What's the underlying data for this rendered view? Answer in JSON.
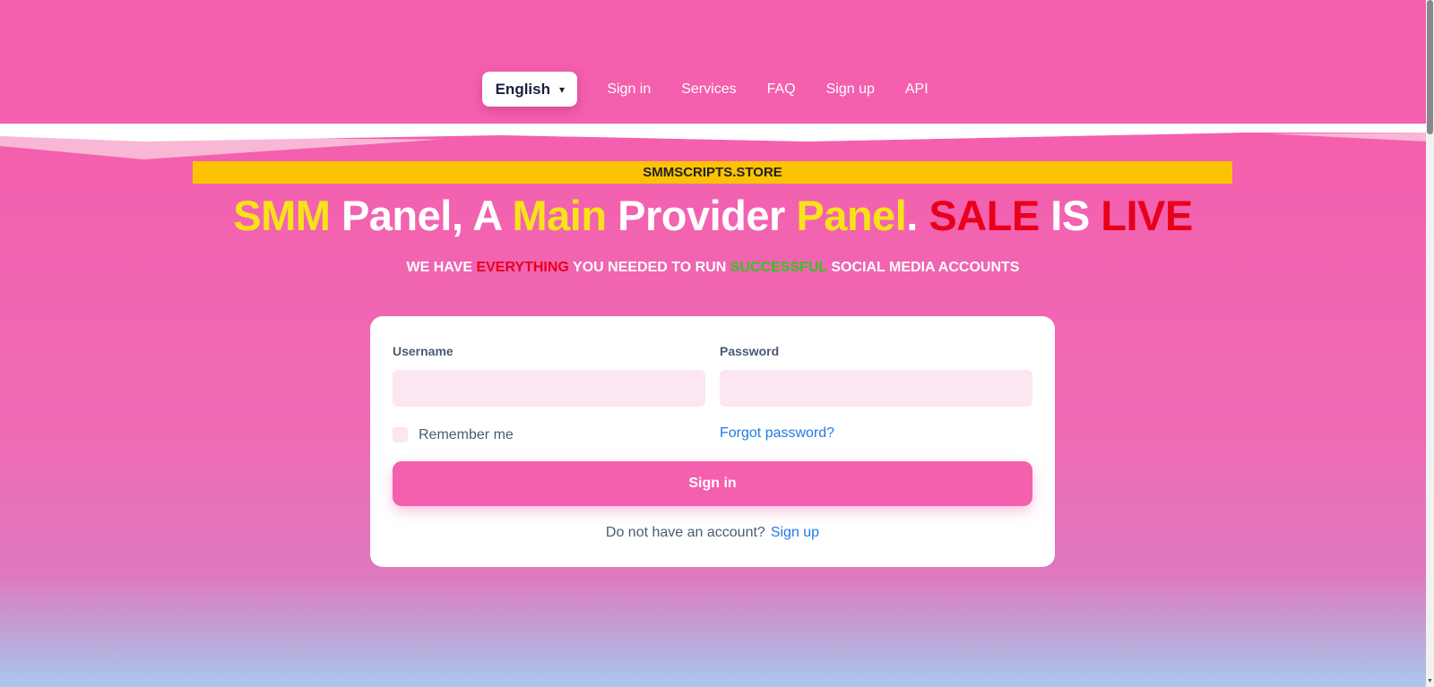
{
  "nav": {
    "language": "English",
    "language_icon": "",
    "items": [
      "Sign in",
      "Services",
      "FAQ",
      "Sign up",
      "API"
    ]
  },
  "banner": "SMMSCRIPTS.STORE",
  "headline": {
    "w1": "SMM",
    "w2": " Panel, A ",
    "w3": "Main",
    "w4": " Provider ",
    "w5": "Panel",
    "w6": ". ",
    "w7": "SALE",
    "w8": " IS ",
    "w9": "LIVE"
  },
  "subheadline": {
    "s1": "WE HAVE ",
    "s2": "EVERYTHING",
    "s3": " YOU NEEDED TO RUN ",
    "s4": "SUCCESSFUL",
    "s5": " SOCIAL MEDIA ACCOUNTS"
  },
  "form": {
    "username_label": "Username",
    "username_value": "",
    "password_label": "Password",
    "password_value": "",
    "remember_label": "Remember me",
    "forgot_link": "Forgot password?",
    "signin_button": "Sign in",
    "no_account_text": "Do not have an account?",
    "signup_link": "Sign up"
  },
  "colors": {
    "brand_pink": "#f45fae",
    "banner_yellow": "#fcc304",
    "accent_yellow": "#f8e21a",
    "accent_red": "#e8001b",
    "accent_green": "#2ec71a",
    "link_blue": "#1e7be3"
  }
}
